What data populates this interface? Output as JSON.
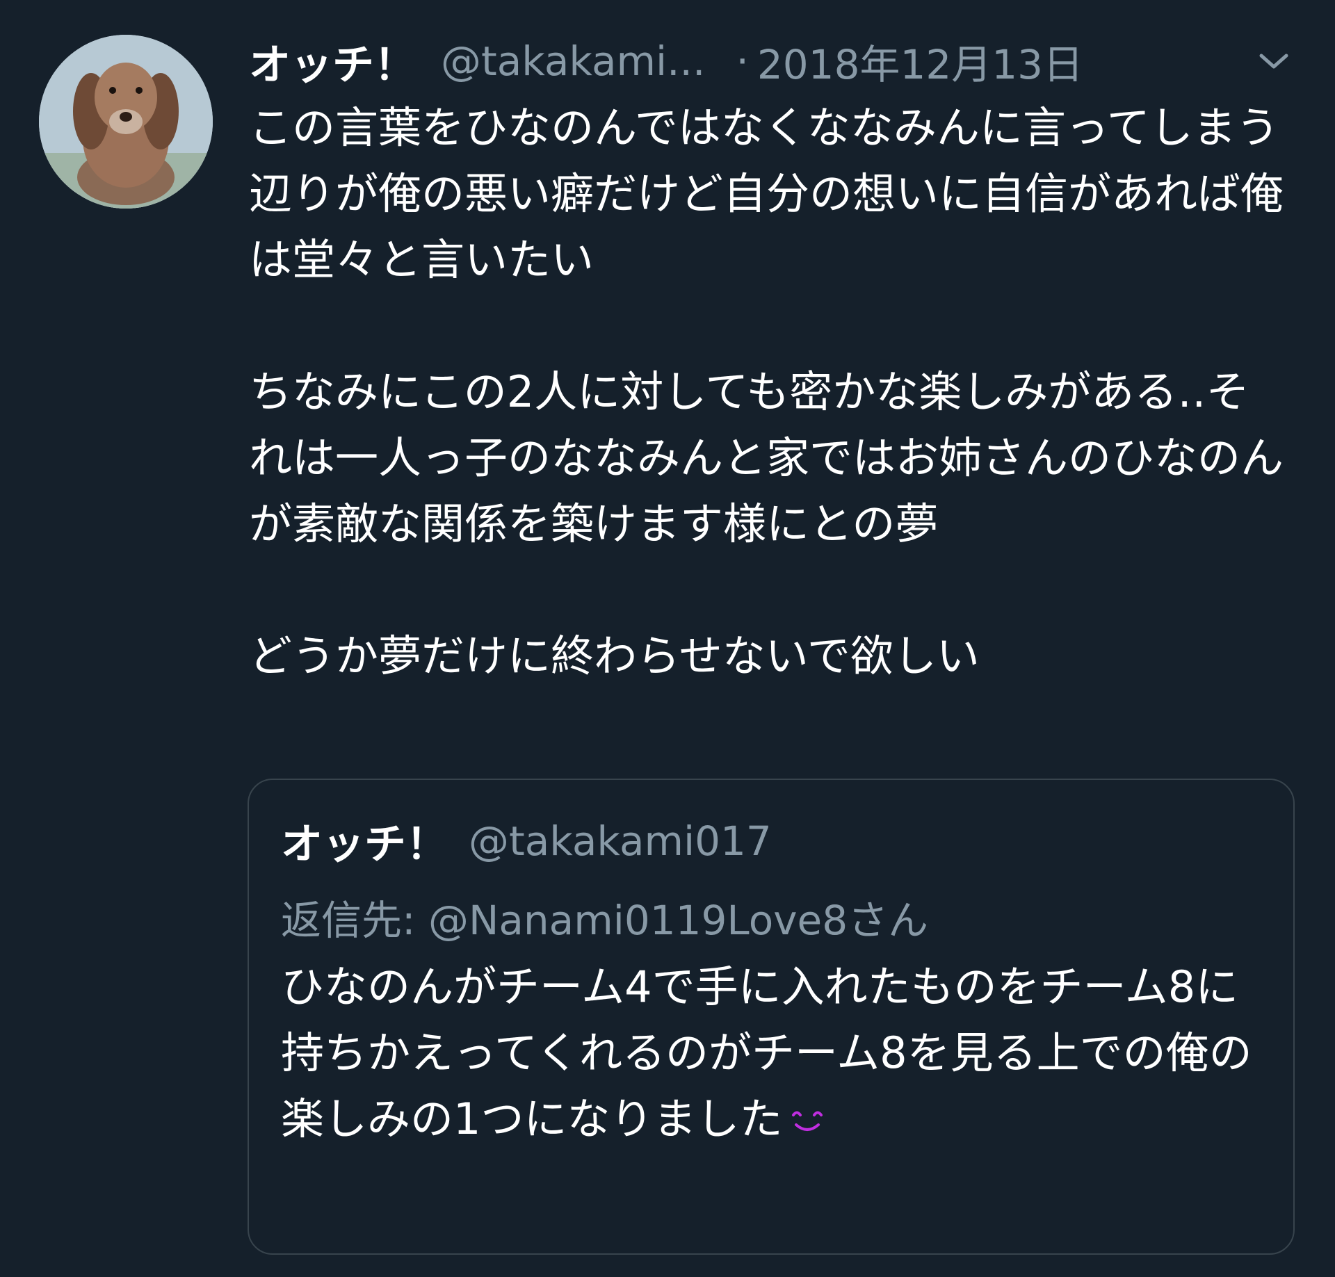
{
  "tweet": {
    "display_name": "オッチ！",
    "handle": "@takakami...",
    "separator": "·",
    "date": "2018年12月13日",
    "body": "この言葉をひなのんではなくななみんに言ってしまう辺りが俺の悪い癖だけど自分の想いに自信があれば俺は堂々と言いたい\n\nちなみにこの2人に対しても密かな楽しみがある‥それは一人っ子のななみんと家ではお姉さんのひなのんが素敵な関係を築けます様にとの夢\n\nどうか夢だけに終わらせないで欲しい",
    "menu_icon": "chevron-down-icon"
  },
  "quoted_tweet": {
    "display_name": "オッチ！",
    "handle": "@takakami017",
    "reply_to": "返信先: @Nanami0119Love8さん",
    "body": "ひなのんがチーム4で手に入れたものをチーム8に持ちかえってくれるのがチーム8を見る上での俺の楽しみの1つになりました",
    "emoji": "smiling-face-icon"
  },
  "colors": {
    "background": "#15202b",
    "text": "#ffffff",
    "secondary_text": "#8899a6",
    "border": "#38444d",
    "emoji": "#c02ee0"
  }
}
